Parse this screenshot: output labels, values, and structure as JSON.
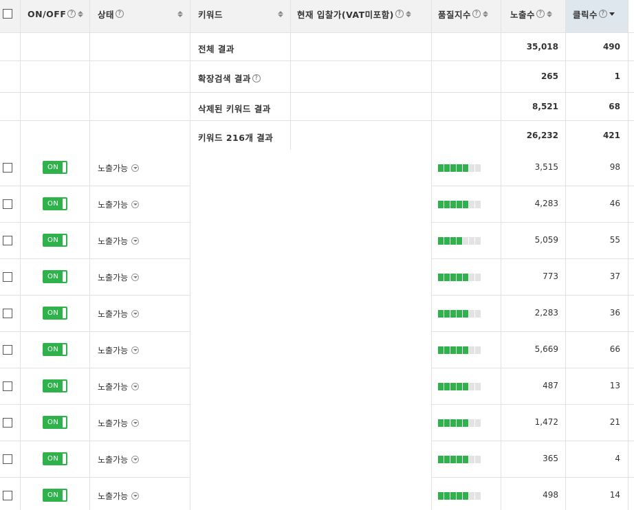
{
  "header": {
    "onoff": "ON/OFF",
    "status": "상태",
    "keyword": "키워드",
    "bid": "현재 입찰가(VAT미포함)",
    "quality": "품질지수",
    "impressions": "노출수",
    "clicks": "클릭수",
    "help_glyph": "?"
  },
  "summary": [
    {
      "label": "전체 결과",
      "help": false,
      "impressions": "35,018",
      "clicks": "490"
    },
    {
      "label": "확장검색 결과",
      "help": true,
      "impressions": "265",
      "clicks": "1"
    },
    {
      "label": "삭제된 키워드 결과",
      "help": false,
      "impressions": "8,521",
      "clicks": "68"
    },
    {
      "label": "키워드 216개 결과",
      "help": false,
      "impressions": "26,232",
      "clicks": "421"
    }
  ],
  "rows": [
    {
      "toggle": "ON",
      "status": "노출가능",
      "quality": 5,
      "impressions": "3,515",
      "clicks": "98"
    },
    {
      "toggle": "ON",
      "status": "노출가능",
      "quality": 5,
      "impressions": "4,283",
      "clicks": "46"
    },
    {
      "toggle": "ON",
      "status": "노출가능",
      "quality": 4,
      "impressions": "5,059",
      "clicks": "55"
    },
    {
      "toggle": "ON",
      "status": "노출가능",
      "quality": 5,
      "impressions": "773",
      "clicks": "37"
    },
    {
      "toggle": "ON",
      "status": "노출가능",
      "quality": 5,
      "impressions": "2,283",
      "clicks": "36"
    },
    {
      "toggle": "ON",
      "status": "노출가능",
      "quality": 5,
      "impressions": "5,669",
      "clicks": "66"
    },
    {
      "toggle": "ON",
      "status": "노출가능",
      "quality": 5,
      "impressions": "487",
      "clicks": "13"
    },
    {
      "toggle": "ON",
      "status": "노출가능",
      "quality": 5,
      "impressions": "1,472",
      "clicks": "21"
    },
    {
      "toggle": "ON",
      "status": "노출가능",
      "quality": 5,
      "impressions": "365",
      "clicks": "4"
    },
    {
      "toggle": "ON",
      "status": "노출가능",
      "quality": 5,
      "impressions": "498",
      "clicks": "14"
    }
  ],
  "quality_max": 7,
  "colors": {
    "toggle_on": "#2fb24c",
    "quality_on": "#2fb24c",
    "sorted_header": "#dfe7ee"
  }
}
